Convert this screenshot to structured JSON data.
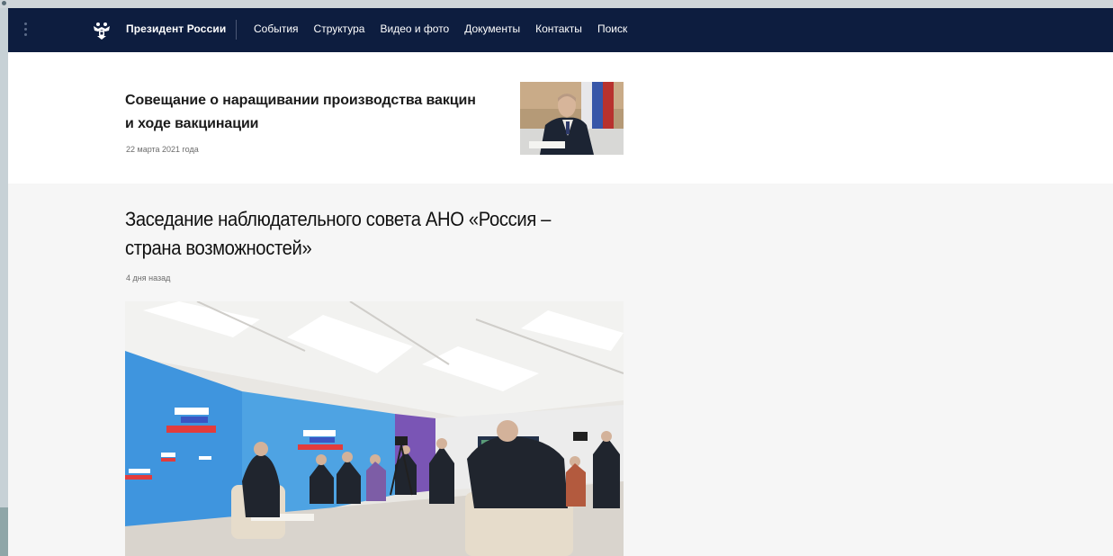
{
  "header": {
    "site_title": "Президент России",
    "nav": [
      "События",
      "Структура",
      "Видео и фото",
      "Документы",
      "Контакты",
      "Поиск"
    ]
  },
  "articles": [
    {
      "title": "Совещание о наращивании производства вакцин и ходе вакцинации",
      "date": "22 марта 2021 года"
    },
    {
      "title": "Заседание наблюдательного совета АНО «Россия – страна возможностей»",
      "date": "4 дня назад"
    }
  ],
  "icons": {
    "menu": "vertical-dots-icon",
    "logo": "double-headed-eagle-emblem"
  },
  "colors": {
    "navbar": "#0d1d3f",
    "white_block": "#ffffff",
    "grey_block": "#f6f6f6"
  }
}
